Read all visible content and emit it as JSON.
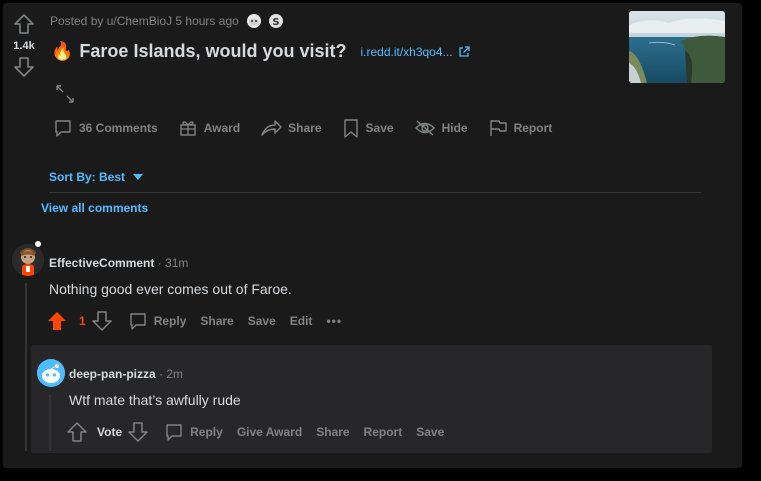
{
  "post": {
    "vote_count": "1.4k",
    "posted_by": "Posted by u/ChemBioJ",
    "time_ago": "5 hours ago",
    "title_emoji": "🔥",
    "title": "Faroe Islands, would you visit?",
    "link_domain": "i.redd.it/xh3qo4...",
    "actions": {
      "comments": "36 Comments",
      "award": "Award",
      "share": "Share",
      "save": "Save",
      "hide": "Hide",
      "report": "Report"
    }
  },
  "sort": {
    "label": "Sort By: Best"
  },
  "view_all": "View all comments",
  "comments": [
    {
      "author": "EffectiveComment",
      "time": "· 31m",
      "body": "Nothing good ever comes out of Faroe.",
      "score": "1",
      "actions": {
        "reply": "Reply",
        "share": "Share",
        "save": "Save",
        "edit": "Edit",
        "more": "•••"
      }
    },
    {
      "author": "deep-pan-pizza",
      "time": "· 2m",
      "body": "Wtf mate that’s awfully rude",
      "vote_label": "Vote",
      "actions": {
        "reply": "Reply",
        "give_award": "Give Award",
        "share": "Share",
        "report": "Report",
        "save": "Save"
      }
    }
  ],
  "colors": {
    "accent": "#4fbcff",
    "upvote": "#ff4500",
    "muted": "#818384",
    "text": "#d7dadc",
    "card": "#1a1a1b"
  }
}
